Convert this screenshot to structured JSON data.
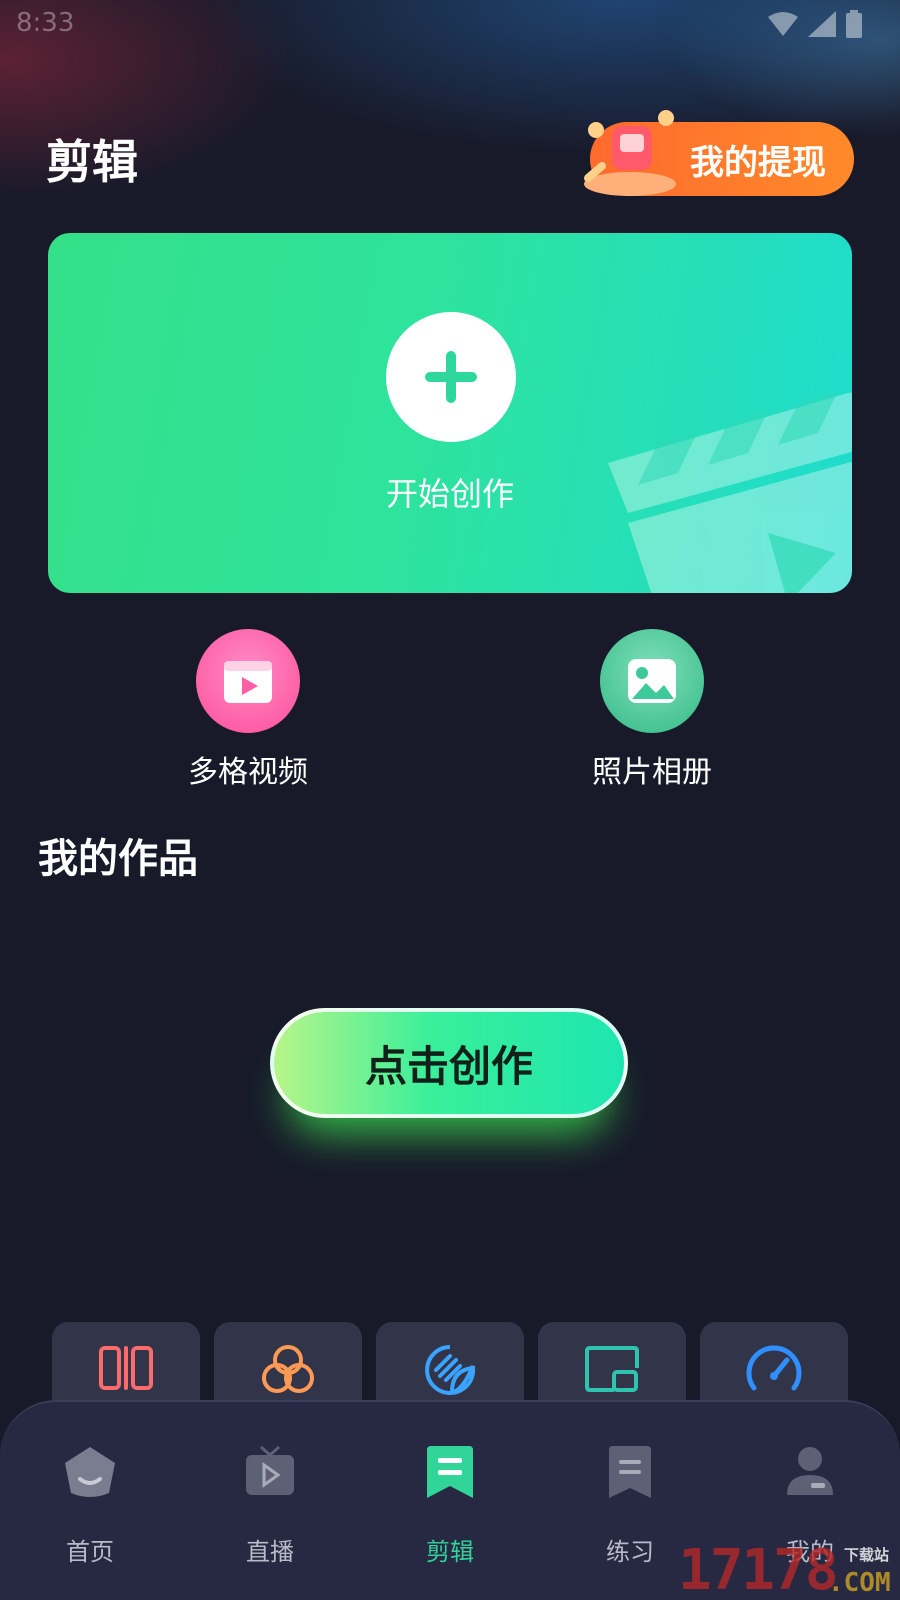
{
  "status_bar": {
    "time": "8:33"
  },
  "header": {
    "title": "剪辑",
    "withdraw_label": "我的提现"
  },
  "create_card": {
    "label": "开始创作"
  },
  "quick_actions": [
    {
      "label": "多格视频",
      "icon": "film-play-icon",
      "color": "#ff6fb3"
    },
    {
      "label": "照片相册",
      "icon": "photo-album-icon",
      "color": "#3ec99a"
    }
  ],
  "works": {
    "title": "我的作品",
    "cta_label": "点击创作"
  },
  "tools": [
    {
      "icon": "split-icon",
      "color": "#ff6b6b"
    },
    {
      "icon": "filter-icon",
      "color": "#ff9a55"
    },
    {
      "icon": "sticker-icon",
      "color": "#3aa3ff"
    },
    {
      "icon": "picture-in-picture-icon",
      "color": "#2fc4b0"
    },
    {
      "icon": "speed-icon",
      "color": "#2f8fff"
    }
  ],
  "bottom_nav": [
    {
      "label": "首页",
      "icon": "home-icon",
      "active": false
    },
    {
      "label": "直播",
      "icon": "live-tv-icon",
      "active": false
    },
    {
      "label": "剪辑",
      "icon": "edit-icon",
      "active": true
    },
    {
      "label": "练习",
      "icon": "practice-icon",
      "active": false
    },
    {
      "label": "我的",
      "icon": "profile-icon",
      "active": false
    }
  ],
  "watermark": {
    "number": "17178",
    "suffix": ".COM",
    "site": "下载站"
  }
}
